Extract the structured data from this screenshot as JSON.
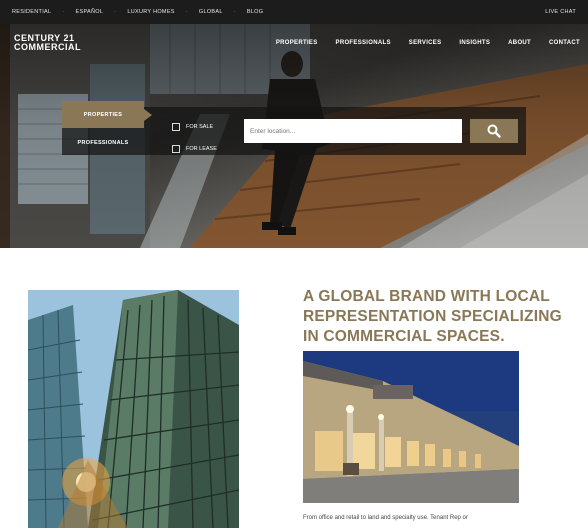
{
  "topbar": {
    "links": [
      "RESIDENTIAL",
      "ESPAÑOL",
      "LUXURY HOMES",
      "GLOBAL",
      "BLOG"
    ],
    "chat_label": "LIVE CHAT"
  },
  "brand": {
    "line1": "CENTURY 21",
    "line2": "COMMERCIAL"
  },
  "nav": {
    "items": [
      "PROPERTIES",
      "PROFESSIONALS",
      "SERVICES",
      "INSIGHTS",
      "ABOUT",
      "CONTACT"
    ]
  },
  "search": {
    "tabs": [
      "PROPERTIES",
      "PROFESSIONALS"
    ],
    "options": [
      "FOR SALE",
      "FOR LEASE"
    ],
    "placeholder": "Enter location..."
  },
  "content": {
    "headline_lines": [
      "A GLOBAL BRAND WITH LOCAL",
      "REPRESENTATION SPECIALIZING",
      "IN COMMERCIAL SPACES."
    ],
    "body": "From office and retail to land and specialty use. Tenant Rep or"
  },
  "colors": {
    "accent": "#8a7756",
    "topbar": "#1c1c1c"
  },
  "icons": {
    "search": "magnifier-icon"
  }
}
